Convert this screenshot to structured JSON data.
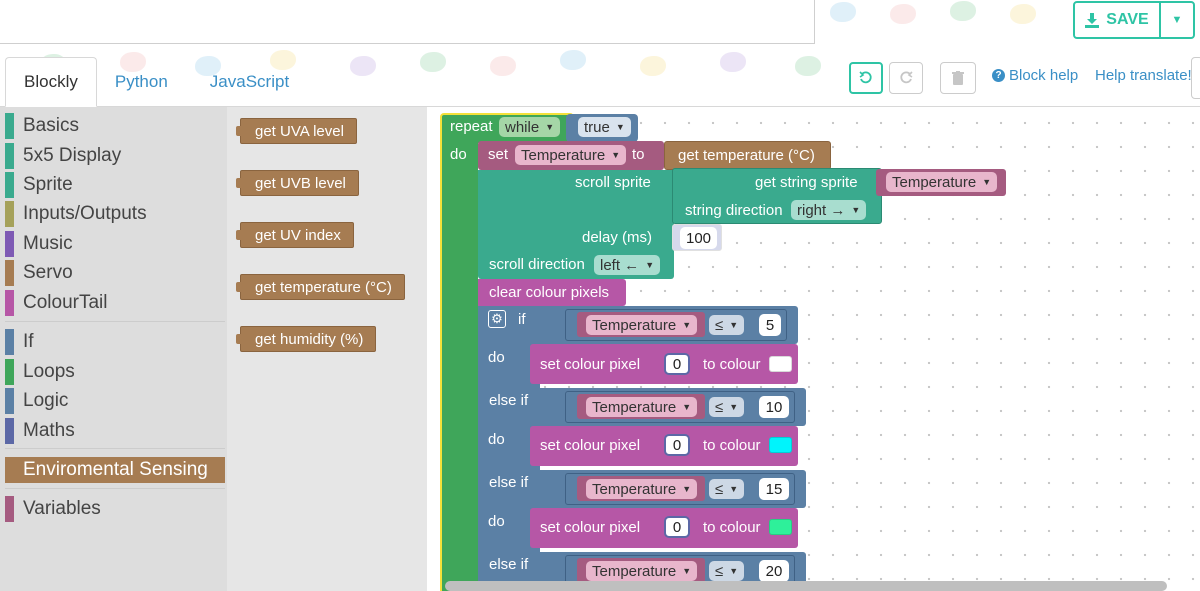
{
  "header": {
    "save_label": "SAVE"
  },
  "tabs": [
    {
      "label": "Blockly"
    },
    {
      "label": "Python"
    },
    {
      "label": "JavaScript"
    }
  ],
  "toolbar": {
    "block_help": "Block help",
    "help_translate": "Help translate!"
  },
  "toolbox": {
    "categories": [
      {
        "label": "Basics",
        "color": "#3aaa8e"
      },
      {
        "label": "5x5 Display",
        "color": "#3aaa8e"
      },
      {
        "label": "Sprite",
        "color": "#3aaa8e"
      },
      {
        "label": "Inputs/Outputs",
        "color": "#a5a15a"
      },
      {
        "label": "Music",
        "color": "#7e5ab4"
      },
      {
        "label": "Servo",
        "color": "#a67c52"
      },
      {
        "label": "ColourTail",
        "color": "#b657a6"
      },
      {
        "label": "If",
        "color": "#5b80a5"
      },
      {
        "label": "Loops",
        "color": "#3fa65a"
      },
      {
        "label": "Logic",
        "color": "#5b80a5"
      },
      {
        "label": "Maths",
        "color": "#5c68a6"
      },
      {
        "label": "Enviromental Sensing",
        "color": "#a67c52"
      },
      {
        "label": "Variables",
        "color": "#a55b80"
      }
    ]
  },
  "flyout": {
    "blocks": [
      {
        "label": "get UVA level"
      },
      {
        "label": "get UVB level"
      },
      {
        "label": "get UV index"
      },
      {
        "label": "get temperature (°C)"
      },
      {
        "label": "get humidity (%)"
      }
    ]
  },
  "workspace": {
    "repeat": {
      "label": "repeat",
      "mode": "while",
      "cond": "true",
      "do": "do"
    },
    "set": {
      "label": "set",
      "var": "Temperature",
      "to": "to",
      "value": "get temperature (°C)"
    },
    "scroll": {
      "label": "scroll sprite",
      "get_string": "get string sprite",
      "var": "Temperature",
      "string_direction": "string direction",
      "string_direction_value": "right →",
      "delay": "delay (ms)",
      "delay_value": "100",
      "scroll_direction": "scroll direction",
      "scroll_direction_value": "left ←"
    },
    "clear": "clear colour pixels",
    "if_block": {
      "if": "if",
      "else_if": "else if",
      "do": "do",
      "var": "Temperature",
      "op": "≤",
      "set_pixel": "set colour pixel",
      "to_colour": "to colour",
      "pixel": "0",
      "thresholds": [
        "5",
        "10",
        "15",
        "20"
      ],
      "colours": [
        "#ffffff",
        "#00f4fc",
        "#2ef09a"
      ]
    }
  }
}
